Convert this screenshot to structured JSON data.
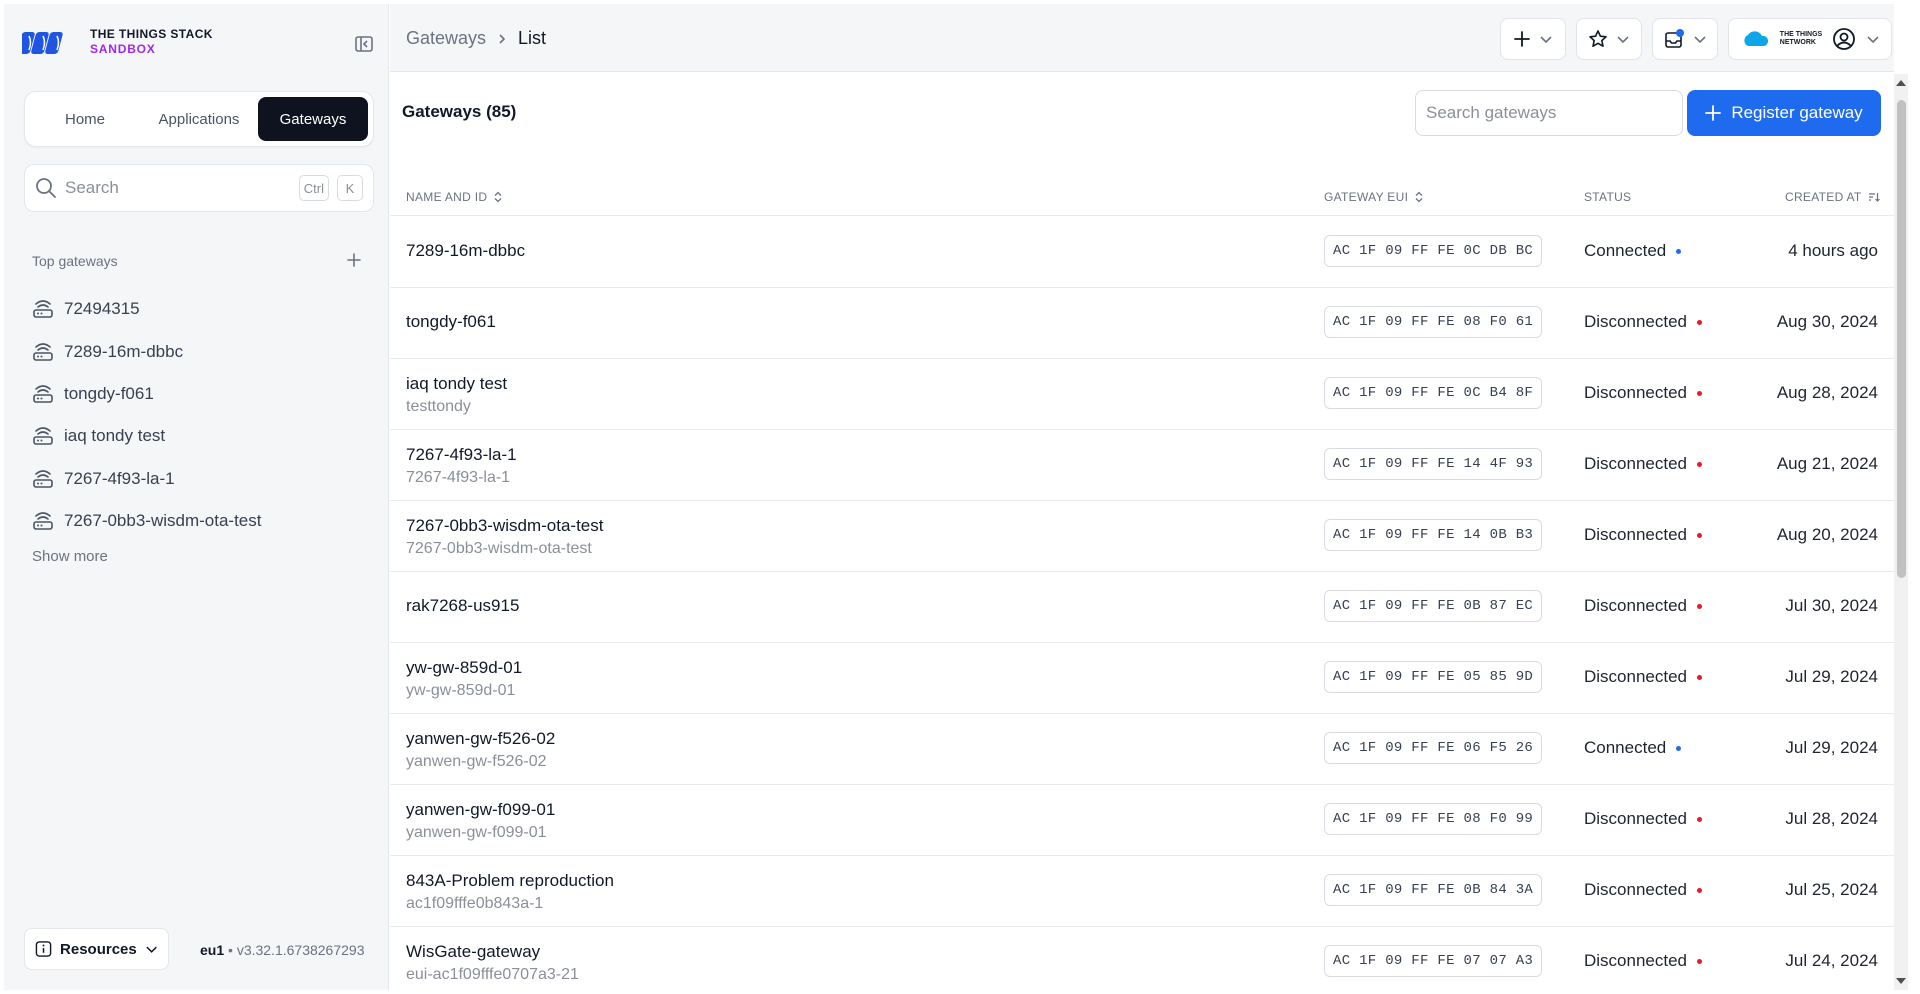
{
  "app": {
    "brand_line1": "THE THINGS STACK",
    "brand_line2": "SANDBOX"
  },
  "sidebar": {
    "tabs": [
      {
        "label": "Home"
      },
      {
        "label": "Applications"
      },
      {
        "label": "Gateways",
        "active": true
      }
    ],
    "search": {
      "placeholder": "Search",
      "kbd1": "Ctrl",
      "kbd2": "K"
    },
    "top_gateways_title": "Top gateways",
    "top_gateways": [
      {
        "label": "72494315"
      },
      {
        "label": "7289-16m-dbbc"
      },
      {
        "label": "tongdy-f061"
      },
      {
        "label": "iaq tondy test"
      },
      {
        "label": "7267-4f93-la-1"
      },
      {
        "label": "7267-0bb3-wisdm-ota-test"
      }
    ],
    "show_more": "Show more",
    "resources": "Resources",
    "cluster": "eu1",
    "separator": " • ",
    "version": "v3.32.1.6738267293"
  },
  "topbar": {
    "breadcrumb_1": "Gateways",
    "breadcrumb_2": "List",
    "network_label_1": "THE THINGS",
    "network_label_2": "NETWORK"
  },
  "main": {
    "title": "Gateways (85)",
    "search_placeholder": "Search gateways",
    "register_button": "Register gateway",
    "columns": {
      "name": "NAME AND ID",
      "eui": "GATEWAY EUI",
      "status": "STATUS",
      "created": "CREATED AT"
    },
    "rows": [
      {
        "name": "7289-16m-dbbc",
        "id": "",
        "eui": "AC 1F 09 FF FE 0C DB BC",
        "status": "Connected",
        "created": "4 hours ago"
      },
      {
        "name": "tongdy-f061",
        "id": "",
        "eui": "AC 1F 09 FF FE 08 F0 61",
        "status": "Disconnected",
        "created": "Aug 30, 2024"
      },
      {
        "name": "iaq tondy test",
        "id": "testtondy",
        "eui": "AC 1F 09 FF FE 0C B4 8F",
        "status": "Disconnected",
        "created": "Aug 28, 2024"
      },
      {
        "name": "7267-4f93-la-1",
        "id": "7267-4f93-la-1",
        "eui": "AC 1F 09 FF FE 14 4F 93",
        "status": "Disconnected",
        "created": "Aug 21, 2024"
      },
      {
        "name": "7267-0bb3-wisdm-ota-test",
        "id": "7267-0bb3-wisdm-ota-test",
        "eui": "AC 1F 09 FF FE 14 0B B3",
        "status": "Disconnected",
        "created": "Aug 20, 2024"
      },
      {
        "name": "rak7268-us915",
        "id": "",
        "eui": "AC 1F 09 FF FE 0B 87 EC",
        "status": "Disconnected",
        "created": "Jul 30, 2024"
      },
      {
        "name": "yw-gw-859d-01",
        "id": "yw-gw-859d-01",
        "eui": "AC 1F 09 FF FE 05 85 9D",
        "status": "Disconnected",
        "created": "Jul 29, 2024"
      },
      {
        "name": "yanwen-gw-f526-02",
        "id": "yanwen-gw-f526-02",
        "eui": "AC 1F 09 FF FE 06 F5 26",
        "status": "Connected",
        "created": "Jul 29, 2024"
      },
      {
        "name": "yanwen-gw-f099-01",
        "id": "yanwen-gw-f099-01",
        "eui": "AC 1F 09 FF FE 08 F0 99",
        "status": "Disconnected",
        "created": "Jul 28, 2024"
      },
      {
        "name": "843A-Problem reproduction",
        "id": "ac1f09fffe0b843a-1",
        "eui": "AC 1F 09 FF FE 0B 84 3A",
        "status": "Disconnected",
        "created": "Jul 25, 2024"
      },
      {
        "name": "WisGate-gateway",
        "id": "eui-ac1f09fffe0707a3-21",
        "eui": "AC 1F 09 FF FE 07 07 A3",
        "status": "Disconnected",
        "created": "Jul 24, 2024"
      }
    ]
  },
  "colors": {
    "primary": "#1f6bf0",
    "brand_purple": "#a128e8",
    "connected": "#1f6bf0",
    "disconnected": "#e11d2e",
    "active_tab": "#0f1320"
  }
}
